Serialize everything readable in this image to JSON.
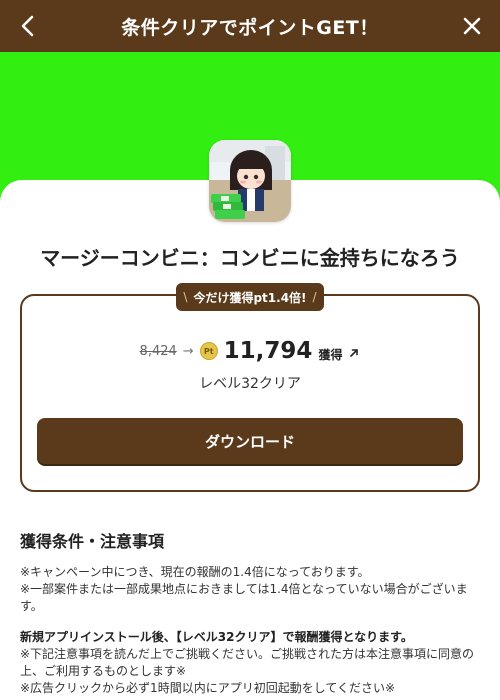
{
  "header": {
    "title": "条件クリアでポイントGET！",
    "back_icon": "chevron-left-icon",
    "close_icon": "close-icon"
  },
  "hero": {
    "background_color": "#33ee11"
  },
  "app": {
    "title": "マージーコンビニ：コンビニに金持ちになろう",
    "icon": "app-icon"
  },
  "offer": {
    "badge_text": "今だけ獲得pt1.4倍!",
    "badge_left": "\\",
    "badge_right": "/",
    "old_points": "8,424",
    "arrow": "→",
    "coin_label": "Pt",
    "new_points": "11,794",
    "earn_label": "獲得",
    "level_text": "レベル32クリア",
    "download_label": "ダウンロード"
  },
  "conditions": {
    "heading": "獲得条件・注意事項",
    "lines": [
      "※キャンペーン中につき、現在の報酬の1.4倍になっております。",
      "※一部案件または一部成果地点におきましては1.4倍となっていない場合がございます。",
      "新規アプリインストール後、【レベル32クリア】で報酬獲得となります。",
      "※下記注意事項を読んだ上でご挑戦ください。ご挑戦された方は本注意事項に同意の上、ご利用するものとします※",
      "※広告クリックから必ず1時間以内にアプリ初回起動をしてください※"
    ]
  },
  "colors": {
    "brand_brown": "#5a3a1a",
    "hero_green": "#33ee11"
  }
}
